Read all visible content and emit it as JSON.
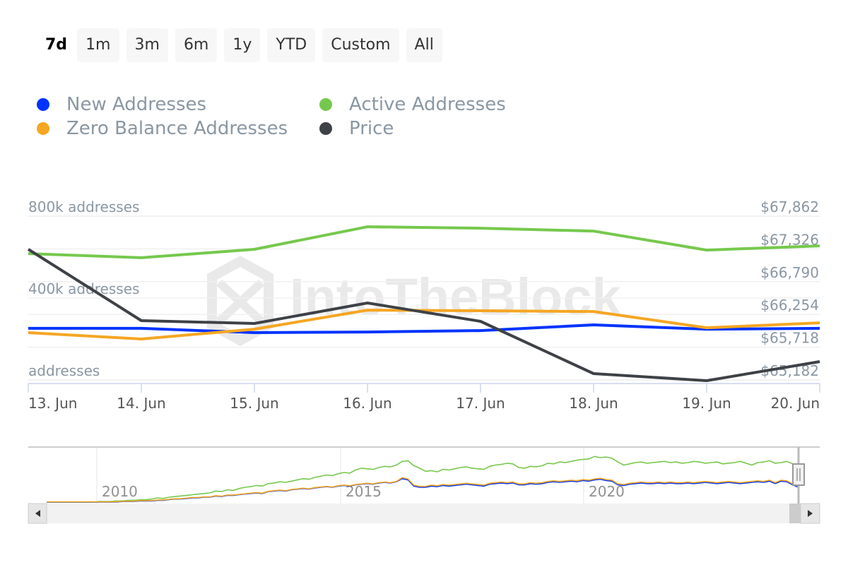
{
  "range_selector": {
    "buttons": [
      {
        "label": "7d",
        "active": true
      },
      {
        "label": "1m",
        "active": false
      },
      {
        "label": "3m",
        "active": false
      },
      {
        "label": "6m",
        "active": false
      },
      {
        "label": "1y",
        "active": false
      },
      {
        "label": "YTD",
        "active": false
      },
      {
        "label": "Custom",
        "active": false
      },
      {
        "label": "All",
        "active": false
      }
    ]
  },
  "legend": [
    {
      "label": "New Addresses",
      "color": "#0033ff"
    },
    {
      "label": "Active Addresses",
      "color": "#76c84d"
    },
    {
      "label": "Zero Balance Addresses",
      "color": "#f5a623"
    },
    {
      "label": "Price",
      "color": "#3e4247"
    }
  ],
  "watermark": "IntoTheBlock",
  "chart_data": {
    "type": "line",
    "title": "",
    "x": [
      "13. Jun",
      "14. Jun",
      "15. Jun",
      "16. Jun",
      "17. Jun",
      "18. Jun",
      "19. Jun",
      "20. Jun"
    ],
    "left_axis": {
      "label": "addresses",
      "ticks": [
        {
          "value": 0,
          "label": "addresses"
        },
        {
          "value": 400000,
          "label": "400k addresses"
        },
        {
          "value": 800000,
          "label": "800k addresses"
        }
      ],
      "range": [
        0,
        800000
      ]
    },
    "right_axis": {
      "label": "Price",
      "ticks": [
        {
          "value": 65182,
          "label": "$65,182"
        },
        {
          "value": 65718,
          "label": "$65,718"
        },
        {
          "value": 66254,
          "label": "$66,254"
        },
        {
          "value": 66790,
          "label": "$66,790"
        },
        {
          "value": 67326,
          "label": "$67,326"
        },
        {
          "value": 67862,
          "label": "$67,862"
        }
      ],
      "range": [
        65182,
        67862
      ]
    },
    "grid": true,
    "legend_position": "top-left",
    "series": [
      {
        "name": "New Addresses",
        "axis": "left",
        "color": "#0033ff",
        "values": [
          252000,
          252000,
          231000,
          234000,
          241000,
          269000,
          248000,
          252000
        ]
      },
      {
        "name": "Active Addresses",
        "axis": "left",
        "color": "#76c84d",
        "values": [
          617000,
          597000,
          638000,
          748000,
          741000,
          727000,
          634000,
          655000
        ]
      },
      {
        "name": "Zero Balance Addresses",
        "axis": "left",
        "color": "#f5a623",
        "values": [
          231000,
          200000,
          248000,
          341000,
          338000,
          334000,
          255000,
          279000
        ]
      },
      {
        "name": "Price",
        "axis": "right",
        "color": "#3e4247",
        "values": [
          67319,
          66152,
          66106,
          66441,
          66141,
          65286,
          65170,
          65482
        ]
      }
    ],
    "navigator": {
      "tick_labels": [
        "2010",
        "2015",
        "2020"
      ],
      "selected_range": "13. Jun - 20. Jun (last 7 days)"
    }
  }
}
